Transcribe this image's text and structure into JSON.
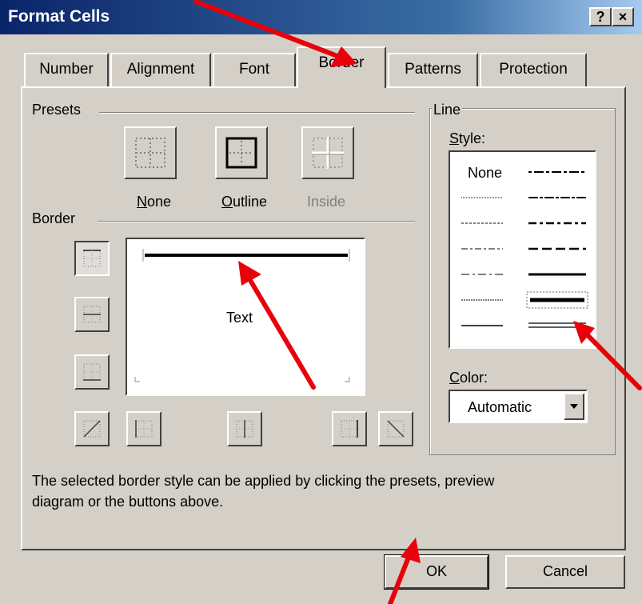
{
  "window": {
    "title": "Format Cells",
    "help_label": "?",
    "close_label": "×"
  },
  "tabs": [
    {
      "label": "Number"
    },
    {
      "label": "Alignment"
    },
    {
      "label": "Font"
    },
    {
      "label": "Border"
    },
    {
      "label": "Patterns"
    },
    {
      "label": "Protection"
    }
  ],
  "active_tab": "Border",
  "presets": {
    "heading": "Presets",
    "items": [
      {
        "label": "None",
        "mnemonic": "N",
        "rest": "one",
        "enabled": true
      },
      {
        "label": "Outline",
        "mnemonic": "O",
        "rest": "utline",
        "enabled": true
      },
      {
        "label": "Inside",
        "enabled": false
      }
    ]
  },
  "border": {
    "heading": "Border",
    "preview_text": "Text"
  },
  "line": {
    "heading": "Line",
    "style_label_mnemonic": "S",
    "style_label_rest": "tyle:",
    "none_label": "None",
    "color_label_mnemonic": "C",
    "color_label_rest": "olor:",
    "color_value": "Automatic"
  },
  "hint_text_1": "The selected border style can be applied by clicking the presets, preview",
  "hint_text_2": "diagram or the buttons above.",
  "buttons": {
    "ok": "OK",
    "cancel": "Cancel"
  },
  "annotation_color": "#e8000b"
}
